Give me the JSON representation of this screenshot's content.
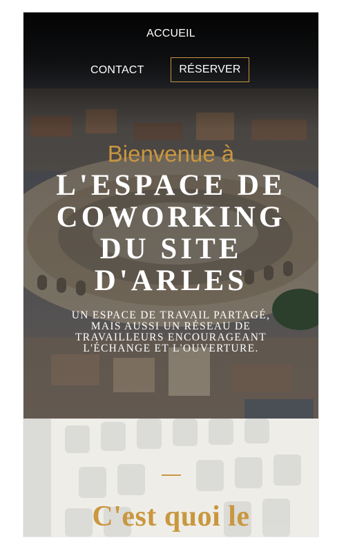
{
  "nav": {
    "home_label": "ACCUEIL",
    "contact_label": "CONTACT",
    "reserve_label": "RÉSERVER"
  },
  "hero": {
    "welcome": "Bienvenue à",
    "title": "L'ESPACE DE\nCOWORKING\nDU SITE\nD'ARLES",
    "subtitle": "UN ESPACE DE TRAVAIL PARTAGÉ,\nMAIS AUSSI UN RÉSEAU DE\nTRAVAILLEURS ENCOURAGEANT\nL'ÉCHANGE ET L'OUVERTURE.",
    "background_image": "arles-arena-aerial-photo"
  },
  "section2": {
    "title": "C'est quoi le",
    "background_image": "blurred-keyboard-photo"
  },
  "colors": {
    "accent_gold": "#c9973f",
    "nav_bg": "#0b0b0b",
    "text_light": "#ffffff",
    "section_bg": "#efeeea"
  }
}
